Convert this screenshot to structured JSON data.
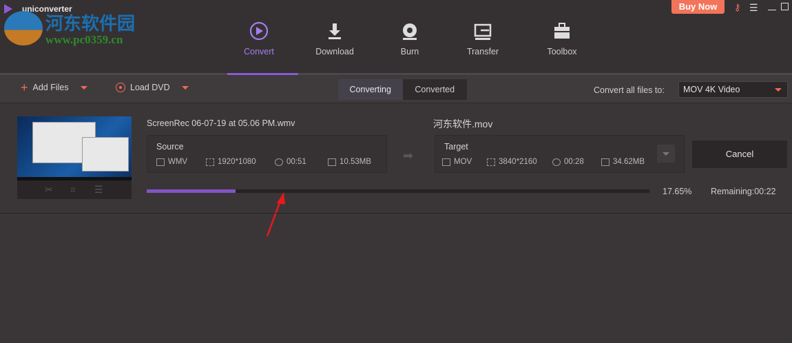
{
  "app": {
    "name": "uniconverter",
    "watermark_title": "河东软件园",
    "watermark_url": "www.pc0359.cn"
  },
  "titlebar": {
    "buy_now": "Buy Now"
  },
  "nav": [
    {
      "label": "Convert",
      "icon": "convert-icon",
      "active": true
    },
    {
      "label": "Download",
      "icon": "download-icon"
    },
    {
      "label": "Burn",
      "icon": "disc-icon"
    },
    {
      "label": "Transfer",
      "icon": "transfer-icon"
    },
    {
      "label": "Toolbox",
      "icon": "toolbox-icon"
    }
  ],
  "toolbar": {
    "add_files": "Add Files",
    "load_dvd": "Load DVD",
    "tabs": [
      "Converting",
      "Converted"
    ],
    "convert_all_label": "Convert all files to:",
    "format": "MOV 4K Video"
  },
  "item": {
    "source_name": "ScreenRec 06-07-19 at 05.06 PM.wmv",
    "source": {
      "label": "Source",
      "format": "WMV",
      "resolution": "1920*1080",
      "duration": "00:51",
      "size": "10.53MB"
    },
    "target_name": "河东软件.mov",
    "target": {
      "label": "Target",
      "format": "MOV",
      "resolution": "3840*2160",
      "duration": "00:28",
      "size": "34.62MB"
    },
    "progress_text": "17.65%",
    "progress": 0.1765,
    "remaining": "Remaining:00:22",
    "cancel": "Cancel"
  },
  "colors": {
    "accent": "#8a5bd0",
    "buy": "#f2745a",
    "arrow": "#e8191a"
  }
}
